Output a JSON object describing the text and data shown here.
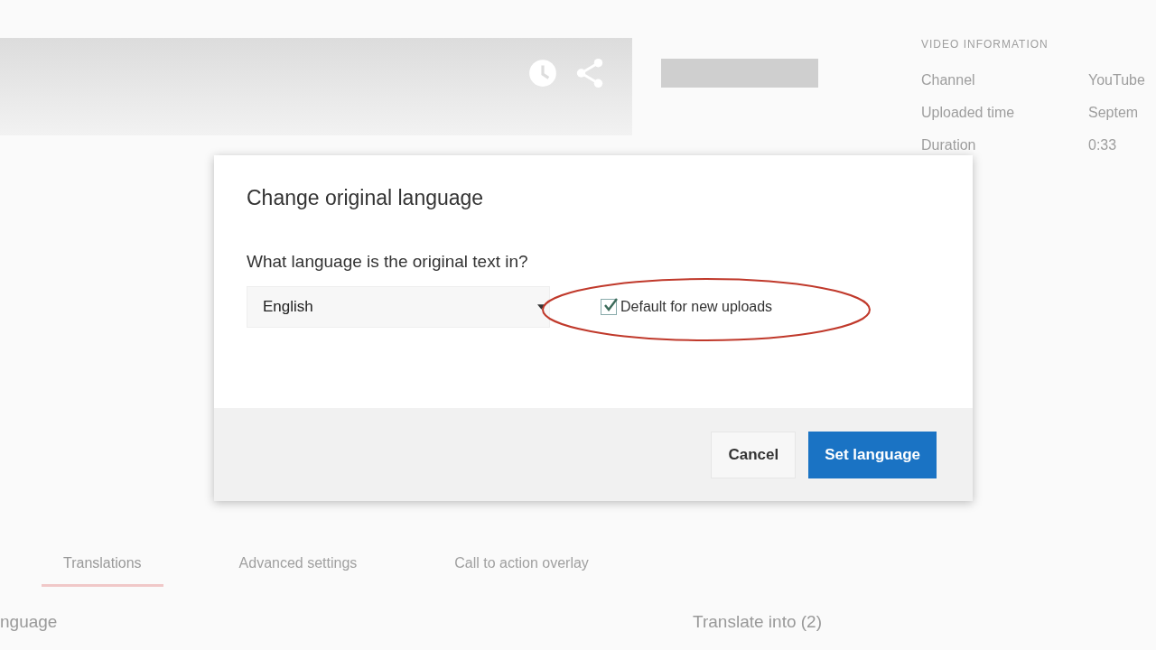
{
  "video_info": {
    "heading": "VIDEO INFORMATION",
    "rows": [
      {
        "label": "Channel",
        "value": "YouTube"
      },
      {
        "label": "Uploaded time",
        "value": "Septem"
      },
      {
        "label": "Duration",
        "value": "0:33"
      }
    ]
  },
  "tabs": [
    {
      "label": "Translations",
      "selected": true
    },
    {
      "label": "Advanced settings",
      "selected": false
    },
    {
      "label": "Call to action overlay",
      "selected": false
    }
  ],
  "left_heading": "nguage",
  "right_heading": "Translate into (2)",
  "dialog": {
    "title": "Change original language",
    "question": "What language is the original text in?",
    "language_select": {
      "value": "English"
    },
    "default_checkbox": {
      "label": "Default for new uploads",
      "checked": true
    },
    "buttons": [
      {
        "label": "Cancel",
        "kind": "secondary"
      },
      {
        "label": "Set language",
        "kind": "primary"
      }
    ]
  }
}
